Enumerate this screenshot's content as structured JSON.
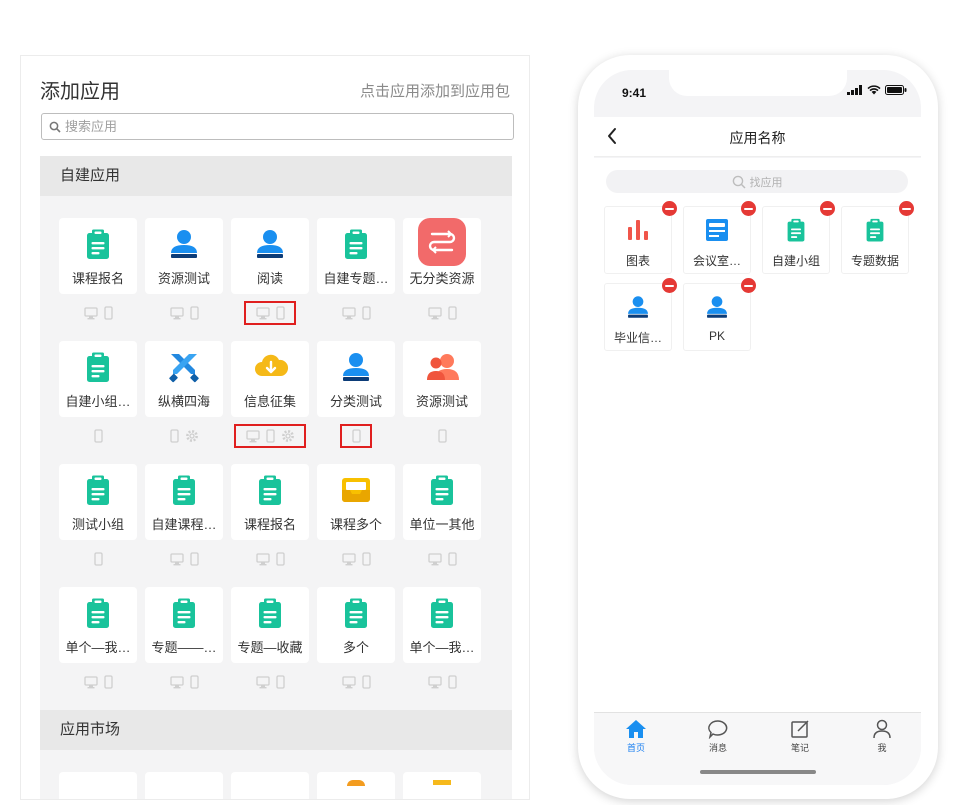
{
  "left_panel": {
    "title": "添加应用",
    "hint": "点击应用添加到应用包",
    "search_placeholder": "搜索应用",
    "section_self": "自建应用",
    "section_market": "应用市场",
    "apps": [
      {
        "label": "课程报名",
        "icon": "clipboard-icon",
        "devices": [
          "desktop",
          "mobile"
        ],
        "highlight": false
      },
      {
        "label": "资源测试",
        "icon": "user-icon",
        "devices": [
          "desktop",
          "mobile"
        ],
        "highlight": false
      },
      {
        "label": "阅读",
        "icon": "user-icon",
        "devices": [
          "desktop",
          "mobile"
        ],
        "highlight": true
      },
      {
        "label": "自建专题…",
        "icon": "clipboard-icon",
        "devices": [
          "desktop",
          "mobile"
        ],
        "highlight": false
      },
      {
        "label": "无分类资源",
        "icon": "switch-icon",
        "devices": [
          "desktop",
          "mobile"
        ],
        "highlight": false
      },
      {
        "label": "自建小组…",
        "icon": "clipboard-icon",
        "devices": [
          "mobile"
        ],
        "highlight": false
      },
      {
        "label": "纵横四海",
        "icon": "swords-icon",
        "devices": [
          "mobile",
          "settings"
        ],
        "highlight": false
      },
      {
        "label": "信息征集",
        "icon": "cloud-download-icon",
        "devices": [
          "desktop",
          "mobile",
          "settings"
        ],
        "highlight": true
      },
      {
        "label": "分类测试",
        "icon": "user-icon",
        "devices": [
          "mobile"
        ],
        "highlight": true
      },
      {
        "label": "资源测试",
        "icon": "people-icon",
        "devices": [
          "mobile"
        ],
        "highlight": false
      },
      {
        "label": "测试小组",
        "icon": "clipboard-icon",
        "devices": [
          "mobile"
        ],
        "highlight": false
      },
      {
        "label": "自建课程…",
        "icon": "clipboard-icon",
        "devices": [
          "desktop",
          "mobile"
        ],
        "highlight": false
      },
      {
        "label": "课程报名",
        "icon": "clipboard-icon",
        "devices": [
          "desktop",
          "mobile"
        ],
        "highlight": false
      },
      {
        "label": "课程多个",
        "icon": "inbox-icon",
        "devices": [
          "desktop",
          "mobile"
        ],
        "highlight": false
      },
      {
        "label": "单位一其他",
        "icon": "clipboard-icon",
        "devices": [
          "desktop",
          "mobile"
        ],
        "highlight": false
      },
      {
        "label": "单个—我…",
        "icon": "clipboard-icon",
        "devices": [
          "desktop",
          "mobile"
        ],
        "highlight": false
      },
      {
        "label": "专题——…",
        "icon": "clipboard-icon",
        "devices": [
          "desktop",
          "mobile"
        ],
        "highlight": false
      },
      {
        "label": "专题—收藏",
        "icon": "clipboard-icon",
        "devices": [
          "desktop",
          "mobile"
        ],
        "highlight": false
      },
      {
        "label": "多个",
        "icon": "clipboard-icon",
        "devices": [
          "desktop",
          "mobile"
        ],
        "highlight": false
      },
      {
        "label": "单个—我…",
        "icon": "clipboard-icon",
        "devices": [
          "desktop",
          "mobile"
        ],
        "highlight": false
      }
    ]
  },
  "phone": {
    "time": "9:41",
    "title": "应用名称",
    "search_placeholder": "找应用",
    "apps": [
      {
        "label": "图表",
        "icon": "bar-chart-icon"
      },
      {
        "label": "会议室…",
        "icon": "document-icon"
      },
      {
        "label": "自建小组",
        "icon": "clipboard-icon"
      },
      {
        "label": "专题数据",
        "icon": "clipboard-icon"
      },
      {
        "label": "毕业信…",
        "icon": "user-icon"
      },
      {
        "label": "PK",
        "icon": "user-icon"
      }
    ],
    "tabs": [
      {
        "label": "首页",
        "icon": "home-icon",
        "active": true
      },
      {
        "label": "消息",
        "icon": "message-icon",
        "active": false
      },
      {
        "label": "笔记",
        "icon": "note-icon",
        "active": false
      },
      {
        "label": "我",
        "icon": "person-icon",
        "active": false
      }
    ]
  },
  "colors": {
    "teal": "#19c39b",
    "blue": "#1a8ff0",
    "highlight_red": "#e01f1f",
    "remove_red": "#e53935",
    "fab_purple": "#6d4fe0"
  }
}
